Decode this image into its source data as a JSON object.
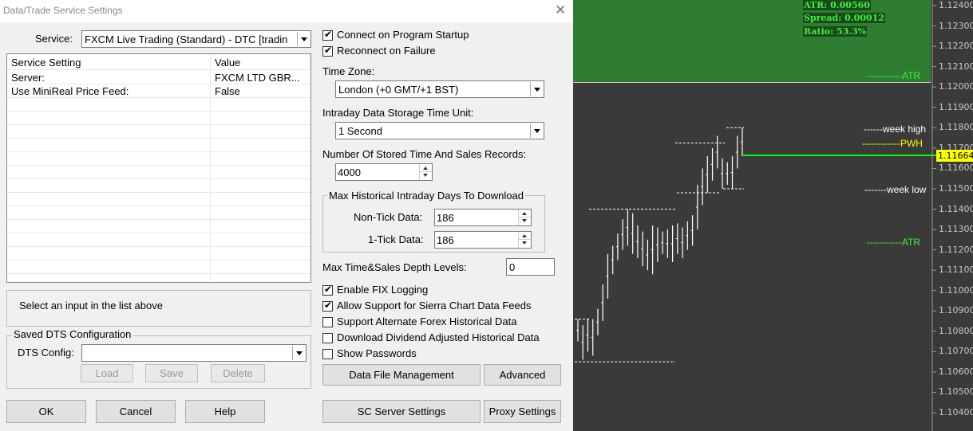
{
  "dialog": {
    "title": "Data/Trade Service Settings",
    "close_glyph": "✕",
    "service_label": "Service:",
    "service_value": "FXCM Live Trading (Standard) - DTC  [tradin",
    "list": {
      "columns": [
        "Service Setting",
        "Value"
      ],
      "rows": [
        {
          "setting": "Server:",
          "value": "FXCM LTD GBR..."
        },
        {
          "setting": "Use MiniReal Price Feed:",
          "value": "False"
        }
      ]
    },
    "description": "Select an input in the list above",
    "saved_dts": {
      "group_label": "Saved DTS Configuration",
      "config_label": "DTS Config:",
      "config_value": "",
      "load": "Load",
      "save": "Save",
      "delete": "Delete"
    },
    "buttons": {
      "ok": "OK",
      "cancel": "Cancel",
      "help": "Help",
      "data_file_management": "Data File Management",
      "advanced": "Advanced",
      "sc_server_settings": "SC Server Settings",
      "proxy_settings": "Proxy Settings"
    },
    "connect_on_startup": {
      "label": "Connect on Program Startup",
      "checked": true
    },
    "reconnect_on_failure": {
      "label": "Reconnect on Failure",
      "checked": true
    },
    "time_zone": {
      "label": "Time Zone:",
      "value": "London (+0 GMT/+1 BST)"
    },
    "storage_unit": {
      "label": "Intraday Data Storage Time Unit:",
      "value": "1 Second"
    },
    "stored_records": {
      "label": "Number Of Stored Time And Sales Records:",
      "value": "4000"
    },
    "max_days": {
      "group_label": "Max Historical Intraday Days To Download",
      "non_tick_label": "Non-Tick Data:",
      "non_tick_value": "186",
      "one_tick_label": "1-Tick Data:",
      "one_tick_value": "186"
    },
    "max_depth": {
      "label": "Max Time&Sales Depth Levels:",
      "value": "0"
    },
    "options": [
      {
        "label": "Enable FIX Logging",
        "checked": true
      },
      {
        "label": "Allow Support for Sierra Chart Data Feeds",
        "checked": true
      },
      {
        "label": "Support Alternate Forex Historical Data",
        "checked": false
      },
      {
        "label": "Download Dividend Adjusted Historical Data",
        "checked": false
      },
      {
        "label": "Show Passwords",
        "checked": false
      }
    ]
  },
  "chart": {
    "info": {
      "atr": "ATR: 0.00560",
      "spread": "Spread: 0.00012",
      "ratio": "Ratio: 53.3%"
    },
    "price_axis": [
      "1.12400",
      "1.12300",
      "1.12200",
      "1.12100",
      "1.12000",
      "1.11900",
      "1.11800",
      "1.11700",
      "1.11600",
      "1.11500",
      "1.11400",
      "1.11300",
      "1.11200",
      "1.11100",
      "1.11000",
      "1.10900",
      "1.10800",
      "1.10700",
      "1.10600",
      "1.10500",
      "1.10400"
    ],
    "current_price": "1.11664",
    "annotations": {
      "atr_upper": "-----------ATR",
      "week_high": "------week high",
      "pwh": "------------PWH",
      "week_low": "-------week low",
      "atr_lower": "-----------ATR"
    },
    "colors": {
      "background": "#3a3a3a",
      "atr_zone": "#2e7d32",
      "price_marker": "#ffff00",
      "current_line": "#00ff00",
      "bars": "#ffffff"
    }
  },
  "chart_data": {
    "type": "bar",
    "y_axis_ticks": [
      1.124,
      1.123,
      1.122,
      1.121,
      1.12,
      1.119,
      1.118,
      1.117,
      1.116,
      1.115,
      1.114,
      1.113,
      1.112,
      1.111,
      1.11,
      1.109,
      1.108,
      1.107,
      1.106,
      1.105,
      1.104
    ],
    "ylim": [
      1.1035,
      1.1245
    ],
    "current_price": 1.11664,
    "levels": {
      "atr_upper": 1.1203,
      "week_high": 1.118,
      "pwh": 1.1174,
      "week_low": 1.115,
      "atr_lower": 1.1126
    },
    "bars_low_high": [
      [
        1.1075,
        1.1086
      ],
      [
        1.1066,
        1.1083
      ],
      [
        1.107,
        1.1086
      ],
      [
        1.1068,
        1.1086
      ],
      [
        1.1078,
        1.1091
      ],
      [
        1.1085,
        1.1103
      ],
      [
        1.1096,
        1.1118
      ],
      [
        1.1108,
        1.1122
      ],
      [
        1.1115,
        1.1128
      ],
      [
        1.112,
        1.1135
      ],
      [
        1.1122,
        1.114
      ],
      [
        1.1118,
        1.1138
      ],
      [
        1.1116,
        1.1132
      ],
      [
        1.1112,
        1.1129
      ],
      [
        1.111,
        1.1125
      ],
      [
        1.1108,
        1.1132
      ],
      [
        1.1114,
        1.1131
      ],
      [
        1.1118,
        1.1129
      ],
      [
        1.1116,
        1.113
      ],
      [
        1.1114,
        1.1132
      ],
      [
        1.1118,
        1.1133
      ],
      [
        1.1116,
        1.1131
      ],
      [
        1.112,
        1.1134
      ],
      [
        1.1122,
        1.1137
      ],
      [
        1.113,
        1.1152
      ],
      [
        1.1142,
        1.116
      ],
      [
        1.1148,
        1.1166
      ],
      [
        1.1154,
        1.117
      ],
      [
        1.116,
        1.1176
      ],
      [
        1.115,
        1.1165
      ],
      [
        1.1152,
        1.1163
      ],
      [
        1.115,
        1.1166
      ],
      [
        1.116,
        1.1176
      ],
      [
        1.1166,
        1.118
      ]
    ]
  }
}
